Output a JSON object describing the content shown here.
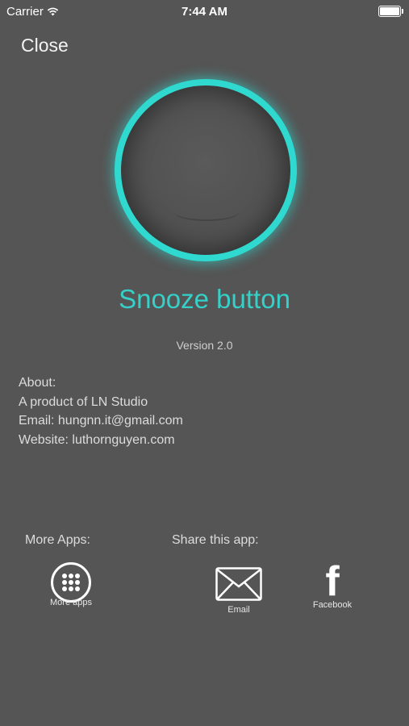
{
  "status": {
    "carrier": "Carrier",
    "time": "7:44 AM",
    "battery_level": 1.0
  },
  "nav": {
    "close_label": "Close"
  },
  "app": {
    "title": "Snooze button",
    "version": "Version 2.0",
    "accent_color": "#2fd9cf"
  },
  "about": {
    "heading": "About:",
    "product": "A product of LN Studio",
    "email": "Email: hungnn.it@gmail.com",
    "website": "Website: luthornguyen.com"
  },
  "more_apps": {
    "label": "More Apps:",
    "button_label": "More apps",
    "icon": "grid-icon"
  },
  "share": {
    "label": "Share this app:",
    "email_label": "Email",
    "email_icon": "envelope-icon",
    "facebook_label": "Facebook",
    "facebook_icon": "facebook-icon"
  }
}
